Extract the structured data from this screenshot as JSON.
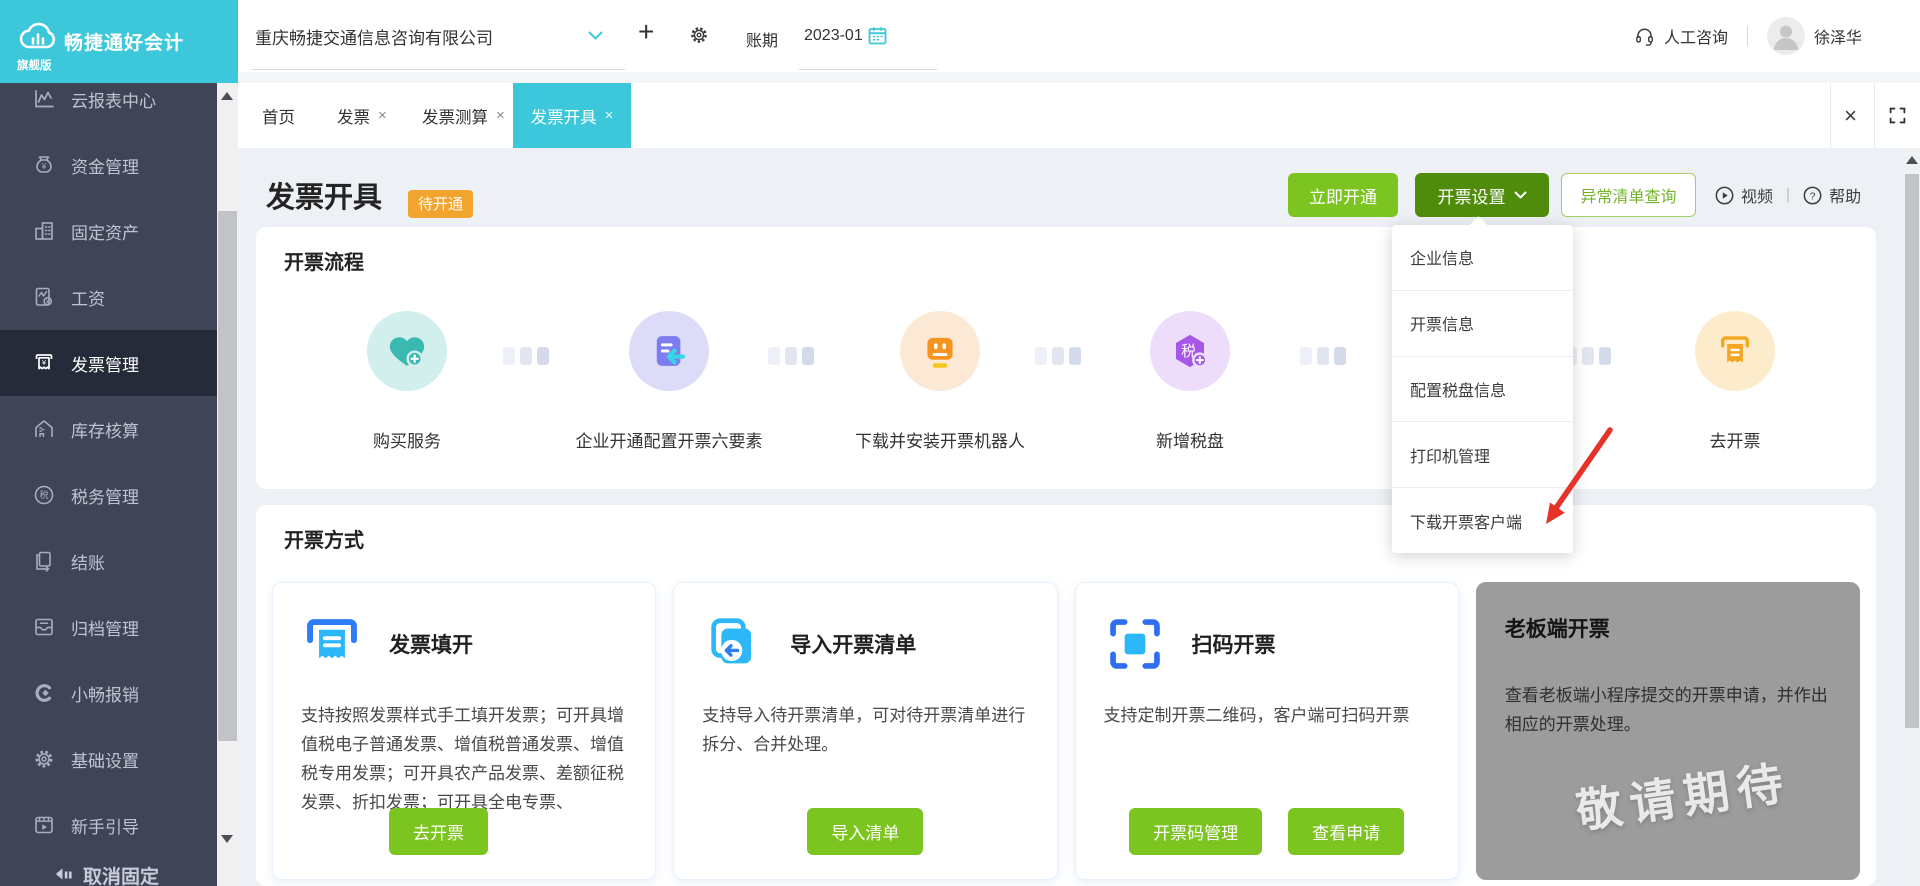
{
  "brand": {
    "name": "畅捷通好会计",
    "edition": "旗舰版"
  },
  "header": {
    "company": "重庆畅捷交通信息咨询有限公司",
    "plus_glyph": "+",
    "period_label": "账期",
    "period_value": "2023-01",
    "support_label": "人工咨询",
    "divider_glyph": "|",
    "user_name": "徐泽华"
  },
  "sidebar": {
    "items": [
      {
        "icon": "chart-icon",
        "label": "云报表中心"
      },
      {
        "icon": "money-bag-icon",
        "label": "资金管理"
      },
      {
        "icon": "building-icon",
        "label": "固定资产"
      },
      {
        "icon": "salary-icon",
        "label": "工资"
      },
      {
        "icon": "invoice-icon",
        "label": "发票管理"
      },
      {
        "icon": "warehouse-icon",
        "label": "库存核算"
      },
      {
        "icon": "tax-icon",
        "label": "税务管理"
      },
      {
        "icon": "settlement-icon",
        "label": "结账"
      },
      {
        "icon": "archive-icon",
        "label": "归档管理"
      },
      {
        "icon": "reimburse-icon",
        "label": "小畅报销"
      },
      {
        "icon": "gear-icon",
        "label": "基础设置"
      },
      {
        "icon": "guide-icon",
        "label": "新手引导"
      }
    ],
    "unpin_label": "取消固定"
  },
  "tabs": {
    "close_glyph": "×",
    "items": [
      {
        "label": "首页"
      },
      {
        "label": "发票"
      },
      {
        "label": "发票测算"
      },
      {
        "label": "发票开具"
      }
    ]
  },
  "page": {
    "title": "发票开具",
    "status_badge": "待开通",
    "open_now_button": "立即开通",
    "invoice_settings_button": "开票设置",
    "abnormal_list_button": "异常清单查询",
    "video_label": "视频",
    "divider_glyph": "|",
    "help_label": "帮助"
  },
  "settings_dropdown": {
    "items": [
      "企业信息",
      "开票信息",
      "配置税盘信息",
      "打印机管理",
      "下载开票客户端"
    ]
  },
  "flow": {
    "heading": "开票流程",
    "steps": [
      {
        "icon": "heart-plus-icon",
        "label": "购买服务"
      },
      {
        "icon": "purple-doc-icon",
        "label": "企业开通配置开票六要素"
      },
      {
        "icon": "robot-icon",
        "label": "下载并安装开票机器人"
      },
      {
        "icon": "tax-disk-icon",
        "label": "新增税盘"
      },
      {
        "icon": "go-invoice-icon",
        "label": "去开票"
      }
    ]
  },
  "methods": {
    "heading": "开票方式",
    "cards": [
      {
        "title": "发票填开",
        "desc": "支持按照发票样式手工填开发票；可开具增值税电子普通发票、增值税普通发票、增值税专用发票；可开具农产品发票、差额征税发票、折扣发票；可开具全电专票、",
        "buttons": [
          "去开票"
        ]
      },
      {
        "title": "导入开票清单",
        "desc": "支持导入待开票清单，可对待开票清单进行拆分、合并处理。",
        "buttons": [
          "导入清单"
        ]
      },
      {
        "title": "扫码开票",
        "desc": "支持定制开票二维码，客户端可扫码开票",
        "buttons": [
          "开票码管理",
          "查看申请"
        ]
      },
      {
        "title": "老板端开票",
        "desc": "查看老板端小程序提交的开票申请，并作出相应的开票处理。",
        "watermark": "敬请期待",
        "buttons": []
      }
    ]
  },
  "glyphs": {
    "yuan": "¥",
    "tax_char": "税",
    "question": "?"
  },
  "colors": {
    "accent_cyan": "#3cc7da",
    "primary_green": "#7cc41f",
    "dark_green": "#4f8c0b",
    "badge_orange": "#f1a42e",
    "arrow_red": "#e5332a",
    "sidebar_dark": "#3f4457"
  }
}
